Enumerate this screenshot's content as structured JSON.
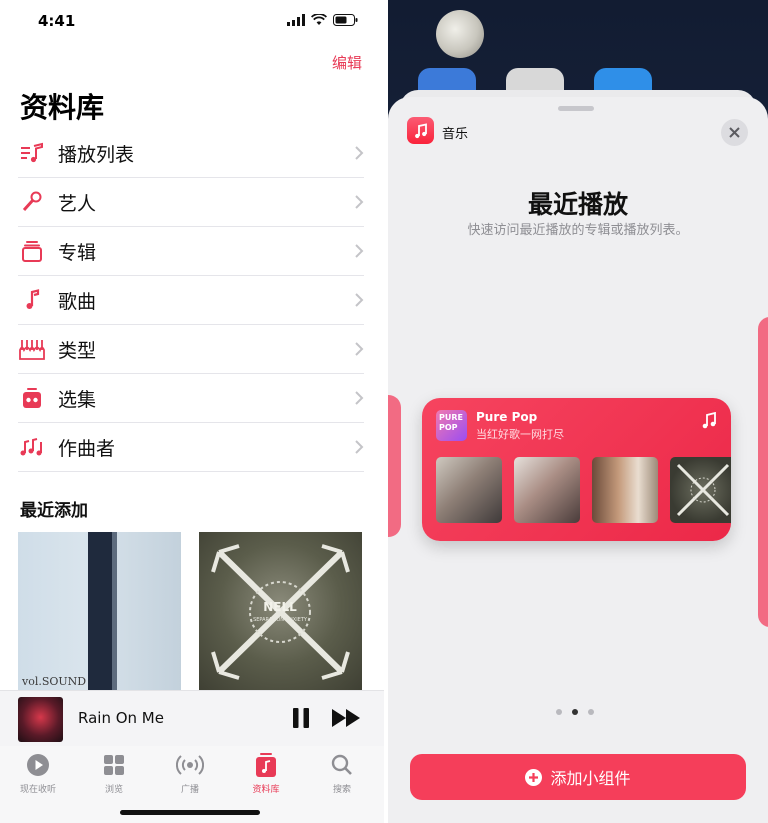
{
  "status_bar": {
    "time": "4:41"
  },
  "library": {
    "edit_label": "编辑",
    "title": "资料库",
    "items": [
      {
        "label": "播放列表",
        "icon": "playlist-icon"
      },
      {
        "label": "艺人",
        "icon": "microphone-icon"
      },
      {
        "label": "专辑",
        "icon": "album-icon"
      },
      {
        "label": "歌曲",
        "icon": "music-note-icon"
      },
      {
        "label": "类型",
        "icon": "genre-icon"
      },
      {
        "label": "选集",
        "icon": "compilation-icon"
      },
      {
        "label": "作曲者",
        "icon": "composer-icon"
      }
    ],
    "recent_title": "最近添加",
    "albums": [
      {
        "cover_text": "vol.SOUND"
      },
      {
        "cover_text": "NELL",
        "cover_subtext": "SEPARATION ANXIETY"
      }
    ]
  },
  "mini_player": {
    "title": "Rain On Me"
  },
  "tabs": [
    {
      "label": "现在收听",
      "icon": "play-circle-icon",
      "active": false
    },
    {
      "label": "浏览",
      "icon": "grid-icon",
      "active": false
    },
    {
      "label": "广播",
      "icon": "broadcast-icon",
      "active": false
    },
    {
      "label": "资料库",
      "icon": "library-icon",
      "active": true
    },
    {
      "label": "搜索",
      "icon": "search-icon",
      "active": false
    }
  ],
  "widget_sheet": {
    "app_name": "音乐",
    "title": "最近播放",
    "subtitle": "快速访问最近播放的专辑或播放列表。",
    "widget": {
      "thumb_text": "PURE POP",
      "playlist_name": "Pure Pop",
      "playlist_desc": "当红好歌一网打尽",
      "covers": [
        "cover-1",
        "cover-2",
        "cover-3",
        "cover-4"
      ]
    },
    "page_dots": {
      "count": 3,
      "active_index": 1
    },
    "add_button_label": "添加小组件"
  },
  "colors": {
    "accent": "#e83a56",
    "widget_red": "#f53e5a"
  }
}
